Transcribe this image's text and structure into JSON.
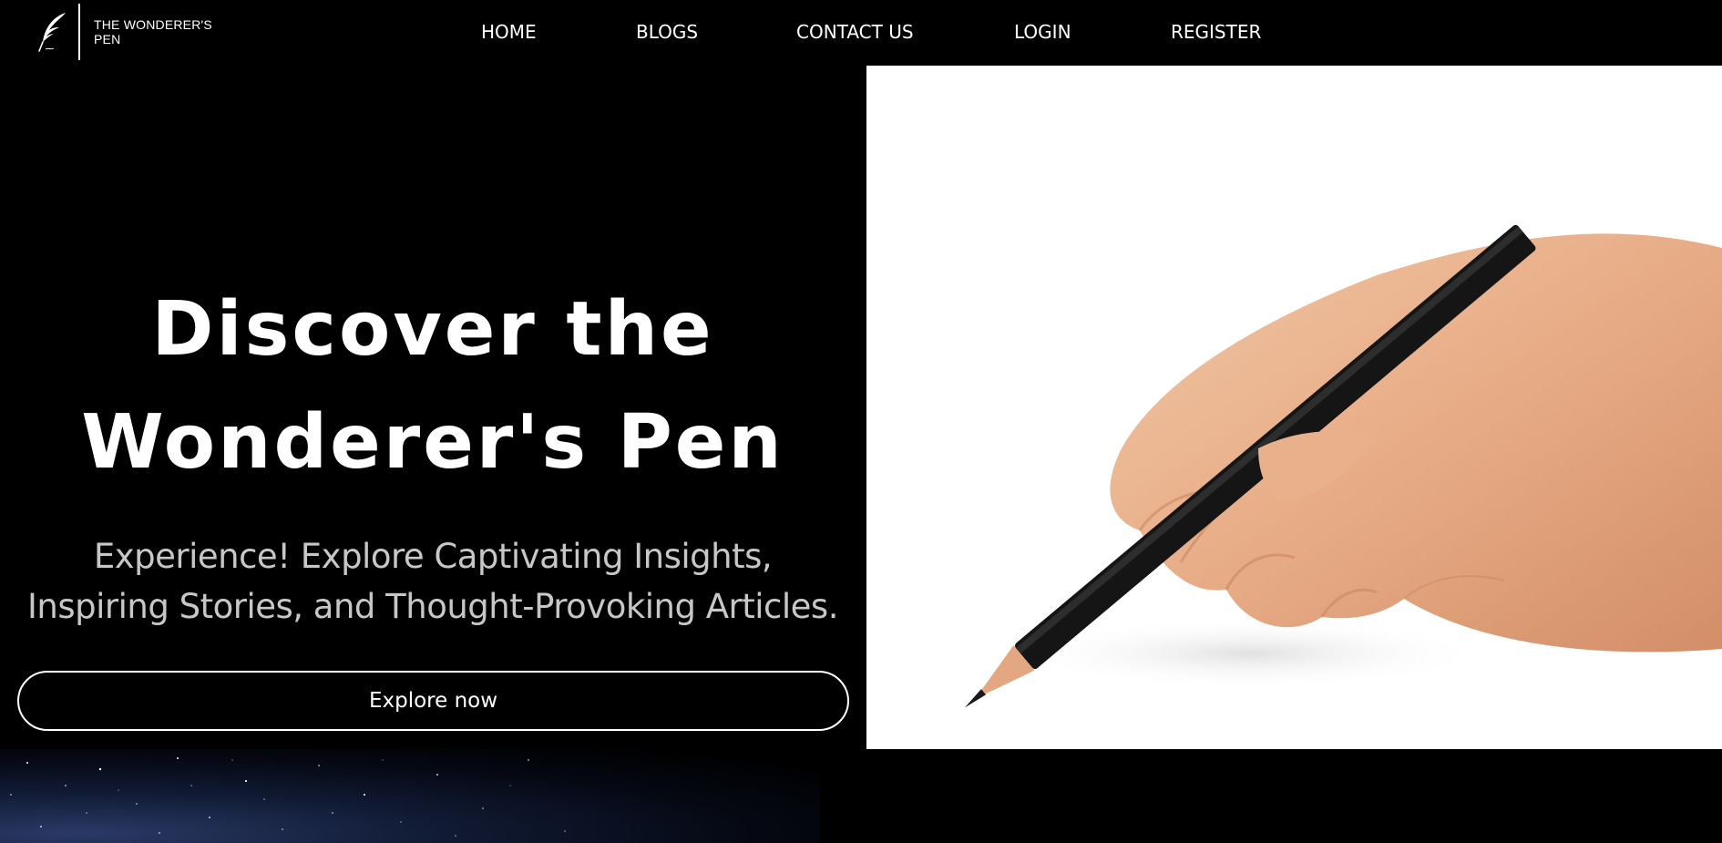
{
  "brand": {
    "name": "THE WONDERER'S PEN",
    "icon": "feather-quill-icon"
  },
  "nav": {
    "items": [
      {
        "label": "HOME"
      },
      {
        "label": "BLOGS"
      },
      {
        "label": "CONTACT US"
      },
      {
        "label": "LOGIN"
      },
      {
        "label": "REGISTER"
      }
    ]
  },
  "hero": {
    "title": "Discover the Wonderer's Pen",
    "subtitle": "Experience! Explore Captivating Insights, Inspiring Stories, and Thought-Provoking Articles.",
    "cta_label": "Explore now",
    "image": "hand-writing-with-pencil"
  },
  "colors": {
    "background": "#000000",
    "text": "#ffffff",
    "subtitle": "#c7c7c7",
    "image_bg": "#ffffff"
  }
}
